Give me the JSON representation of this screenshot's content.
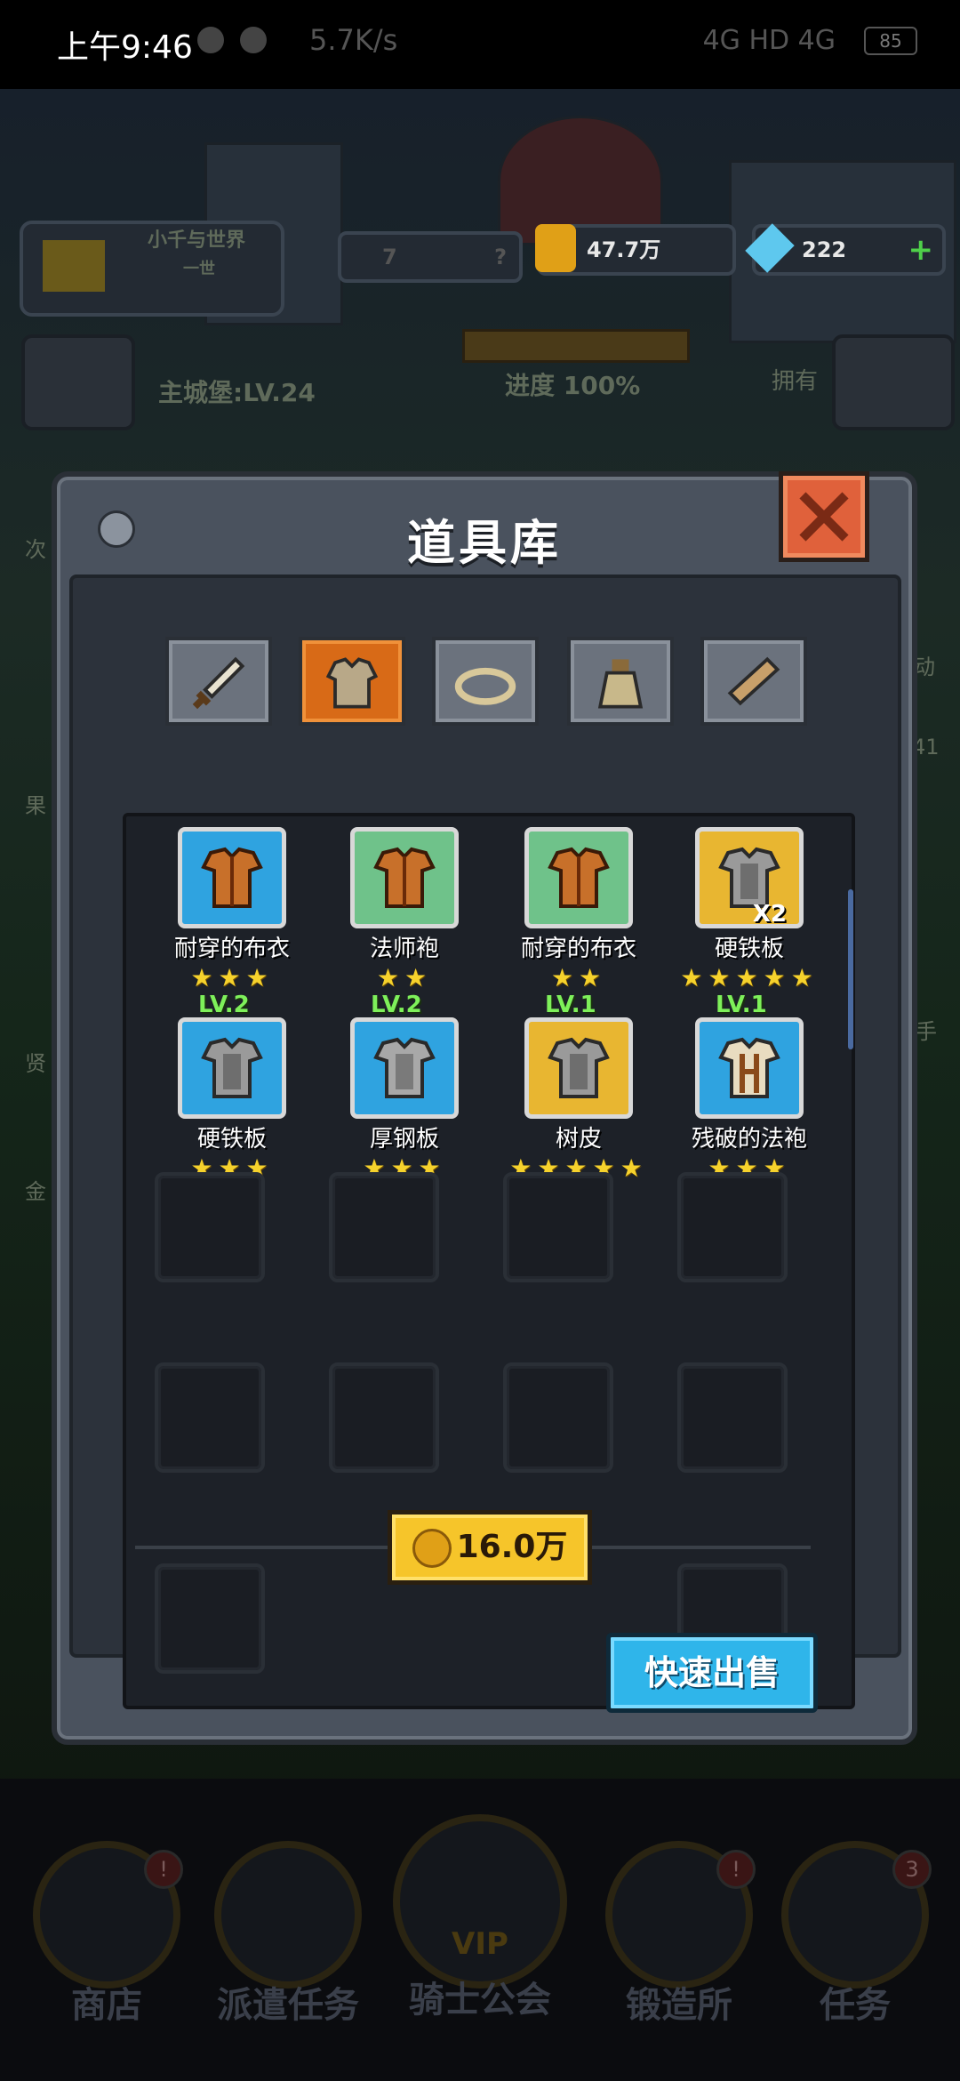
{
  "status_bar": {
    "time": "上午9:46",
    "speed": "5.7K/s",
    "network": "4G HD 4G",
    "battery": "85"
  },
  "hud": {
    "player_name": "小千与世界",
    "player_rank": "一世",
    "keys": "7",
    "question_mark": "?",
    "gold": "47.7万",
    "gems": "222",
    "plus": "+",
    "castle_level": "主城堡:LV.24",
    "progress": "进度 100%",
    "owned": "拥有"
  },
  "modal": {
    "title": "道具库",
    "tabs": [
      {
        "name": "weapon",
        "active": false
      },
      {
        "name": "armor",
        "active": true
      },
      {
        "name": "ring",
        "active": false
      },
      {
        "name": "potion",
        "active": false
      },
      {
        "name": "material",
        "active": false
      }
    ],
    "items": [
      {
        "level": "",
        "name": "耐穿的布衣",
        "stars": "★★★",
        "bg": "blue",
        "count": ""
      },
      {
        "level": "",
        "name": "法师袍",
        "stars": "★★",
        "bg": "green",
        "count": ""
      },
      {
        "level": "",
        "name": "耐穿的布衣",
        "stars": "★★",
        "bg": "green",
        "count": ""
      },
      {
        "level": "",
        "name": "硬铁板",
        "stars": "★★★★★",
        "bg": "gold",
        "count": "X2"
      },
      {
        "level": "LV.2",
        "name": "硬铁板",
        "stars": "★★★",
        "bg": "blue",
        "count": ""
      },
      {
        "level": "LV.2",
        "name": "厚钢板",
        "stars": "★★★",
        "bg": "blue",
        "count": ""
      },
      {
        "level": "LV.1",
        "name": "树皮",
        "stars": "★★★★★",
        "bg": "gold",
        "count": ""
      },
      {
        "level": "LV.1",
        "name": "残破的法袍",
        "stars": "★★★",
        "bg": "blue",
        "count": ""
      }
    ],
    "sell_price": "16.0万",
    "quick_sell": "快速出售"
  },
  "bottom_nav": [
    {
      "label": "商店",
      "badge": "!"
    },
    {
      "label": "派遣任务",
      "badge": ""
    },
    {
      "label": "骑士公会",
      "badge": "",
      "sub": "VIP"
    },
    {
      "label": "锻造所",
      "badge": "!"
    },
    {
      "label": "任务",
      "badge": "3"
    }
  ],
  "side_text": {
    "left_1": "次",
    "left_2": "果",
    "left_3": "贤",
    "left_4": "金",
    "right_1": "动",
    "right_2": "41",
    "right_3": "手"
  }
}
